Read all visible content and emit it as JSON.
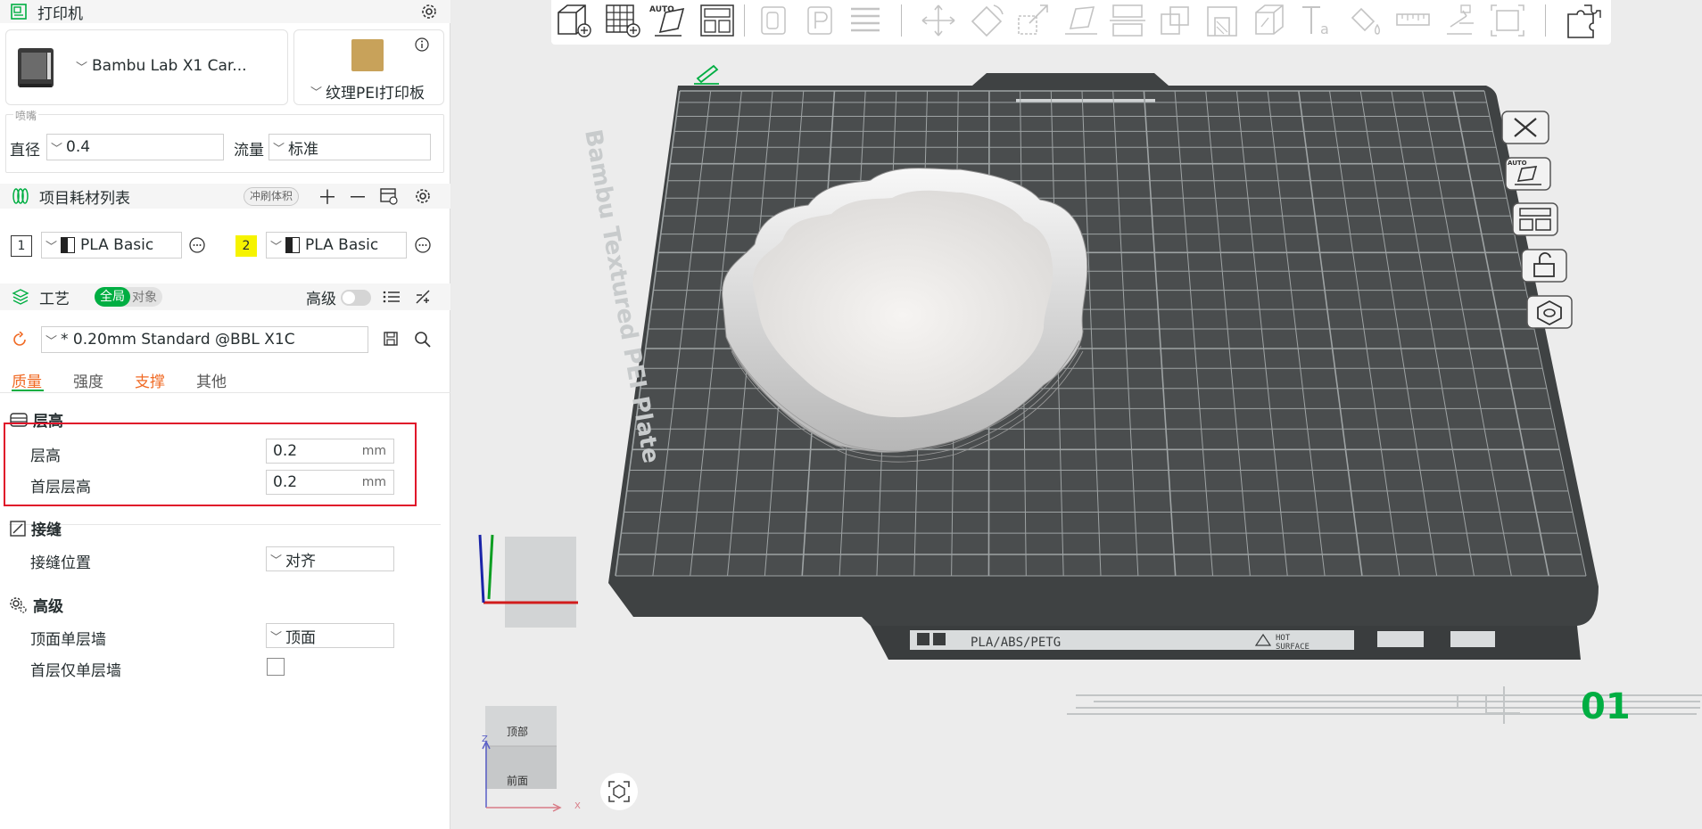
{
  "printer": {
    "section_title": "打印机",
    "model": "Bambu Lab X1 Car...",
    "plate": "纹理PEI打印板"
  },
  "nozzle": {
    "group_title": "喷嘴",
    "diameter_label": "直径",
    "diameter_value": "0.4",
    "flow_label": "流量",
    "flow_value": "标准"
  },
  "filament": {
    "section_title": "项目耗材列表",
    "flush_button": "冲刷体积",
    "slots": [
      {
        "index": "1",
        "name": "PLA Basic",
        "index_bg": "#ffffff"
      },
      {
        "index": "2",
        "name": "PLA Basic",
        "index_bg": "#f6f300"
      }
    ]
  },
  "process": {
    "section_title": "工艺",
    "toggle_global": "全局",
    "toggle_object": "对象",
    "advanced_label": "高级",
    "preset": "* 0.20mm Standard @BBL X1C",
    "tabs": [
      "质量",
      "强度",
      "支撑",
      "其他"
    ],
    "groups": {
      "layer_height": {
        "title": "层高",
        "items": [
          {
            "label": "层高",
            "value": "0.2",
            "unit": "mm"
          },
          {
            "label": "首层层高",
            "value": "0.2",
            "unit": "mm"
          }
        ]
      },
      "seam": {
        "title": "接缝",
        "position_label": "接缝位置",
        "position_value": "对齐"
      },
      "advanced": {
        "title": "高级",
        "top_single_wall_label": "顶面单层墙",
        "top_single_wall_value": "顶面",
        "first_layer_single_wall_label": "首层仅单层墙"
      }
    }
  },
  "viewport": {
    "plate_label": "Bambu Textured PEI Plate",
    "plate_number": "01",
    "plate_strip_text": "PLA/ABS/PETG",
    "hot_surface": [
      "HOT",
      "SURFACE"
    ],
    "auto_label": "AUTO",
    "view_cube": {
      "top": "顶部",
      "front": "前面",
      "axis_x": "X",
      "axis_z": "Z"
    }
  },
  "colors": {
    "accent_green": "#00ae42",
    "support_orange": "#f06b26",
    "highlight_red": "#e0142a",
    "bed_dark": "#4a4d4e",
    "plate_number_green": "#00ae42"
  }
}
